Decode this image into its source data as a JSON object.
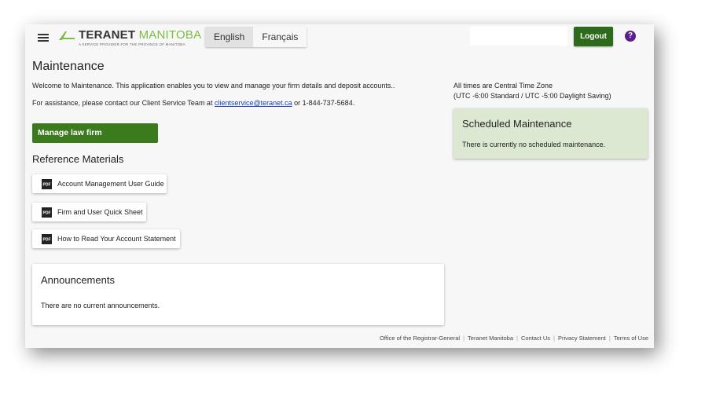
{
  "header": {
    "brand_bold": "TERANET",
    "brand_light": " MANITOBA",
    "brand_tagline": "A SERVICE PROVIDER FOR THE PROVINCE OF MANITOBA",
    "languages": [
      "English",
      "Français"
    ],
    "logout_label": "Logout",
    "help_label": "?"
  },
  "main": {
    "title": "Maintenance",
    "welcome": "Welcome to Maintenance. This application enables you to view and manage your firm details and deposit accounts..",
    "assist_prefix": "For assistance, please contact our Client Service Team at ",
    "assist_email": "clientservice@teranet.ca",
    "assist_suffix": " or 1-844-737-5684.",
    "manage_button": "Manage law firm",
    "reference_title": "Reference Materials",
    "documents": [
      "Account Management User Guide",
      "Firm and User Quick Sheet",
      "How to Read Your Account Statement"
    ],
    "pdf_icon_text": "PDF",
    "announcements_title": "Announcements",
    "announcements_text": "There are no current announcements."
  },
  "side": {
    "timezone_line1": "All times are Central Time Zone",
    "timezone_line2": "(UTC -6:00 Standard / UTC -5:00 Daylight Saving)",
    "scheduled_title": "Scheduled Maintenance",
    "scheduled_text": "There is currently no scheduled maintenance."
  },
  "footer": {
    "links": [
      "Office of the Registrar-General",
      "Teranet Manitoba",
      "Contact Us",
      "Privacy Statement",
      "Terms of Use"
    ],
    "separator": "|"
  },
  "colors": {
    "brand_green": "#7cbc43",
    "button_green": "#3c7a1e",
    "logout_green": "#2d6a1b",
    "help_purple": "#5a1f8a",
    "scheduled_bg": "#dde8d3",
    "link_blue": "#1a3fbf"
  },
  "icons": {
    "menu": "hamburger-icon",
    "logo_mark": "teranet-logo-mark-icon",
    "pdf": "pdf-file-icon",
    "help": "help-circle-icon"
  }
}
